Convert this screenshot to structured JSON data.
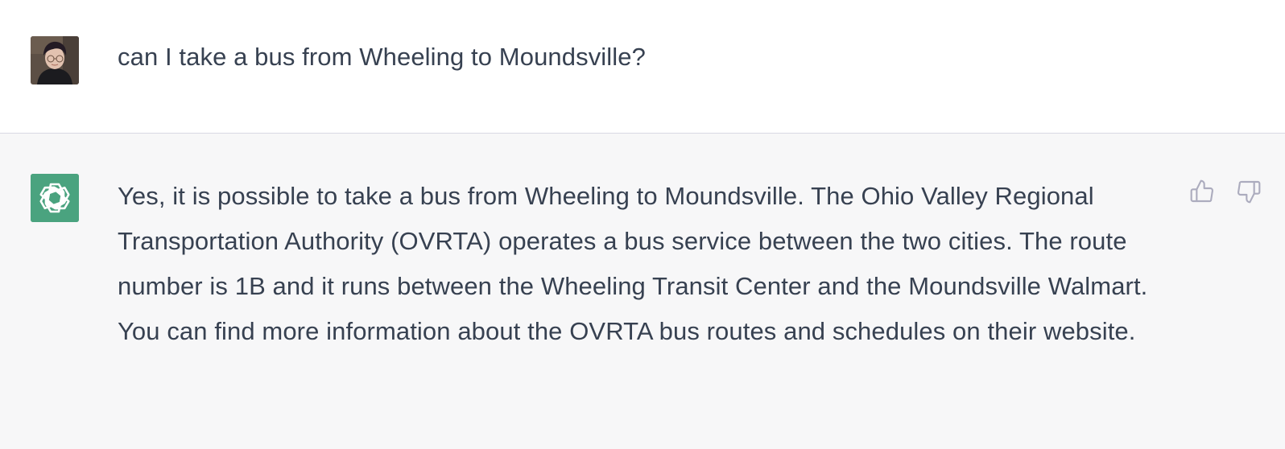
{
  "conversation": {
    "user_message": {
      "avatar": "user-photo-avatar",
      "text": "can I take a bus from Wheeling to Moundsville?"
    },
    "assistant_message": {
      "avatar": "openai-logo-icon",
      "text": "Yes, it is possible to take a bus from Wheeling to Moundsville. The Ohio Valley Regional Transportation Authority (OVRTA) operates a bus service between the two cities. The route number is 1B and it runs between the Wheeling Transit Center and the Moundsville Walmart. You can find more information about the OVRTA bus routes and schedules on their website.",
      "feedback": {
        "thumbs_up_icon": "thumbs-up-icon",
        "thumbs_down_icon": "thumbs-down-icon"
      }
    }
  },
  "colors": {
    "assistant_avatar_bg": "#4aa37f",
    "assistant_row_bg": "#f7f7f8",
    "text": "#374151",
    "icon": "#acacbe"
  }
}
